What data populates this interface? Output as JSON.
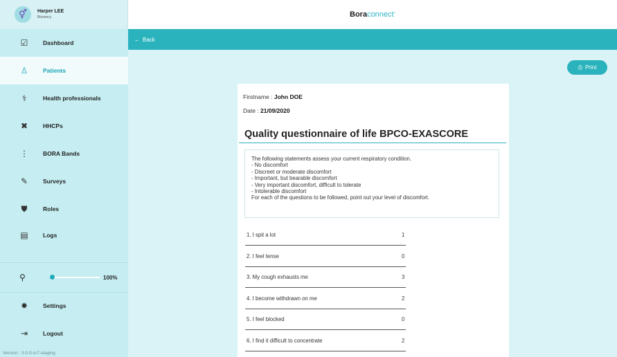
{
  "user": {
    "avatar_glyph": "⚥",
    "name": "Harper LEE",
    "org": "Biosency"
  },
  "brand": {
    "bold": "Bora",
    "light": "connect",
    "sup": "°"
  },
  "sidebar": {
    "items": [
      {
        "label": "Dashboard",
        "icon": "clipboard-check-icon",
        "glyph": "☑"
      },
      {
        "label": "Patients",
        "icon": "user-icon",
        "glyph": "♙"
      },
      {
        "label": "Health professionals",
        "icon": "stethoscope-icon",
        "glyph": "⚕"
      },
      {
        "label": "HHCPs",
        "icon": "tools-icon",
        "glyph": "✖"
      },
      {
        "label": "BORA Bands",
        "icon": "band-icon",
        "glyph": "⋮"
      },
      {
        "label": "Surveys",
        "icon": "survey-icon",
        "glyph": "✎"
      },
      {
        "label": "Roles",
        "icon": "shield-icon",
        "glyph": "⛊"
      },
      {
        "label": "Logs",
        "icon": "document-icon",
        "glyph": "▤"
      }
    ],
    "zoom": {
      "icon_glyph": "⚲",
      "value": "100%",
      "fraction": 0.0
    },
    "settings": {
      "label": "Settings",
      "glyph": "✹"
    },
    "logout": {
      "label": "Logout",
      "glyph": "⇥"
    },
    "version": "Version : 3.0.0-rc7-staging"
  },
  "backbar": {
    "arrow": "←",
    "label": "Back"
  },
  "print": {
    "glyph": "⎙",
    "label": "Print"
  },
  "sheet": {
    "firstname_label": "Firstname : ",
    "firstname_value": "John DOE",
    "date_label": "Date : ",
    "date_value": "21/09/2020",
    "title": "Quality questionnaire of life BPCO-EXASCORE",
    "intro": [
      "The following statements assess your current respiratory condition.",
      "- No discomfort",
      "- Discreet or moderate discomfort",
      "- Important, but bearable discomfort",
      "- Very important discomfort, difficult to tolerate",
      "- Intolerable discomfort",
      "For each of the questions to be followed, point out your level of discomfort."
    ],
    "questions": [
      {
        "text": "1. I spit a lot",
        "score": "1"
      },
      {
        "text": "2. I feel tense",
        "score": "0"
      },
      {
        "text": "3. My cough exhausts me",
        "score": "3"
      },
      {
        "text": "4. I become withdrawn on me",
        "score": "2"
      },
      {
        "text": "5. I feel blocked",
        "score": "0"
      },
      {
        "text": "6. I find it difficult to concentrate",
        "score": "2"
      }
    ]
  },
  "colors": {
    "accent": "#2ab3bd",
    "sidebar": "#c6eef2",
    "content": "#d9f3f6"
  }
}
